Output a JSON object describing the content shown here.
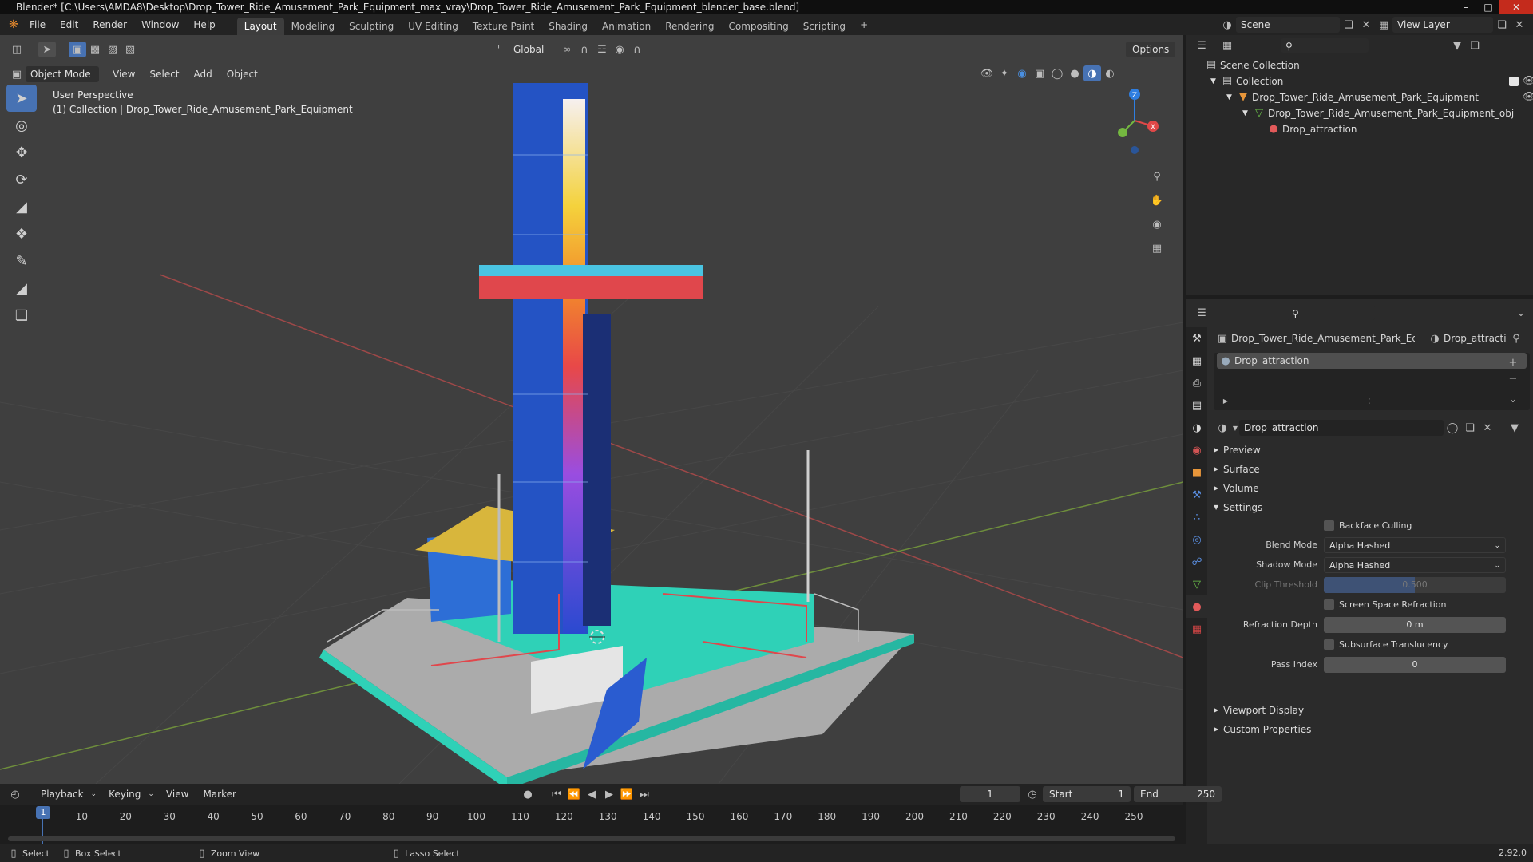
{
  "window": {
    "title": "Blender* [C:\\Users\\AMDA8\\Desktop\\Drop_Tower_Ride_Amusement_Park_Equipment_max_vray\\Drop_Tower_Ride_Amusement_Park_Equipment_blender_base.blend]"
  },
  "menubar": {
    "items": [
      "File",
      "Edit",
      "Render",
      "Window",
      "Help"
    ]
  },
  "workspaces": {
    "tabs": [
      "Layout",
      "Modeling",
      "Sculpting",
      "UV Editing",
      "Texture Paint",
      "Shading",
      "Animation",
      "Rendering",
      "Compositing",
      "Scripting"
    ],
    "active": "Layout",
    "add": "+"
  },
  "scene": {
    "name": "Scene",
    "view_layer": "View Layer"
  },
  "viewport": {
    "transform_orientation": "Global",
    "options": "Options",
    "mode": "Object Mode",
    "menus": [
      "View",
      "Select",
      "Add",
      "Object"
    ],
    "overlay_line1": "User Perspective",
    "overlay_line2": "(1) Collection | Drop_Tower_Ride_Amusement_Park_Equipment",
    "gizmo": {
      "x": "X",
      "y": "Y",
      "z": "Z"
    }
  },
  "outliner": {
    "root": "Scene Collection",
    "items": [
      {
        "label": "Collection",
        "level": 1
      },
      {
        "label": "Drop_Tower_Ride_Amusement_Park_Equipment",
        "level": 2
      },
      {
        "label": "Drop_Tower_Ride_Amusement_Park_Equipment_obj",
        "level": 3
      },
      {
        "label": "Drop_attraction",
        "level": 4
      }
    ]
  },
  "properties": {
    "object_crumb": "Drop_Tower_Ride_Amusement_Park_Equi...",
    "material_crumb": "Drop_attracti...",
    "slot": "Drop_attraction",
    "material_name": "Drop_attraction",
    "panels": {
      "preview": "Preview",
      "surface": "Surface",
      "volume": "Volume",
      "settings": "Settings",
      "viewport_display": "Viewport Display",
      "custom_properties": "Custom Properties"
    },
    "settings": {
      "backface_culling": "Backface Culling",
      "blend_mode_label": "Blend Mode",
      "blend_mode": "Alpha Hashed",
      "shadow_mode_label": "Shadow Mode",
      "shadow_mode": "Alpha Hashed",
      "clip_threshold_label": "Clip Threshold",
      "clip_threshold": "0.500",
      "clip_threshold_fraction": 0.5,
      "screen_space_refraction": "Screen Space Refraction",
      "refraction_depth_label": "Refraction Depth",
      "refraction_depth": "0 m",
      "subsurface_translucency": "Subsurface Translucency",
      "pass_index_label": "Pass Index",
      "pass_index": "0"
    }
  },
  "timeline": {
    "menus": [
      "Playback",
      "Keying",
      "View",
      "Marker"
    ],
    "current_frame": "1",
    "start_label": "Start",
    "start": "1",
    "end_label": "End",
    "end": "250",
    "ticks": [
      "1",
      "10",
      "20",
      "30",
      "40",
      "50",
      "60",
      "70",
      "80",
      "90",
      "100",
      "110",
      "120",
      "130",
      "140",
      "150",
      "160",
      "170",
      "180",
      "190",
      "200",
      "210",
      "220",
      "230",
      "240",
      "250"
    ]
  },
  "statusbar": {
    "select": "Select",
    "box_select": "Box Select",
    "zoom_view": "Zoom View",
    "lasso_select": "Lasso Select",
    "version": "2.92.0"
  },
  "colors": {
    "accent": "#4772b3",
    "active_slot": "#4f4f4f",
    "tower_blue": "#2453c4",
    "ride_red": "#e0474c",
    "base_teal": "#2fd1b7"
  }
}
